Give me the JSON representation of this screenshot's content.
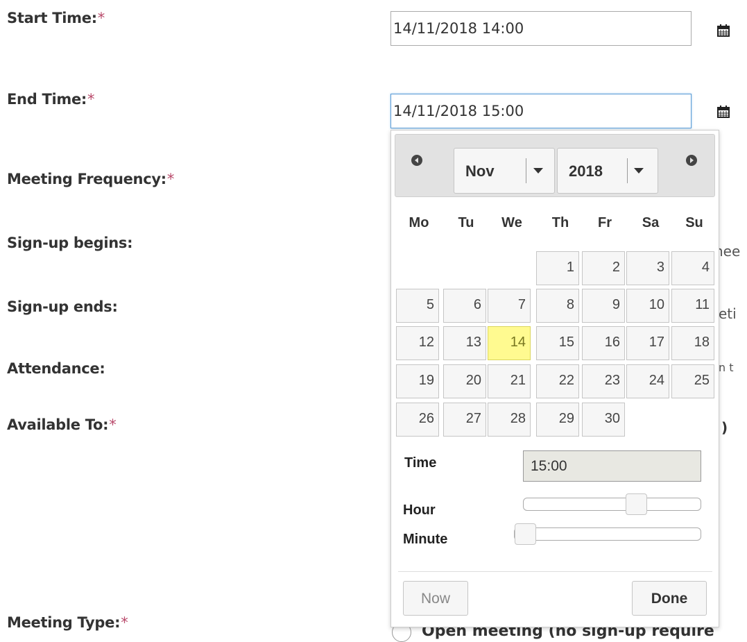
{
  "form": {
    "start_time_label": "Start Time:",
    "end_time_label": "End Time:",
    "meeting_frequency_label": "Meeting Frequency:",
    "signup_begins_label": "Sign-up begins:",
    "signup_ends_label": "Sign-up ends:",
    "attendance_label": "Attendance:",
    "available_to_label": "Available To:",
    "meeting_type_label": "Meeting Type:",
    "required_marker": "*",
    "start_time_value": "14/11/2018 14:00",
    "end_time_value": "14/11/2018 15:00"
  },
  "background_fragments": {
    "signup_begins_frag": "nee",
    "signup_ends_frag": "eti",
    "attendance_frag": "n t",
    "available_to_frag": ")",
    "meeting_type_option": "Open meeting (no sign-up require"
  },
  "datepicker": {
    "month": "Nov",
    "year": "2018",
    "weekdays": [
      "Mo",
      "Tu",
      "We",
      "Th",
      "Fr",
      "Sa",
      "Su"
    ],
    "weeks": [
      [
        "",
        "",
        "",
        "1",
        "2",
        "3",
        "4"
      ],
      [
        "5",
        "6",
        "7",
        "8",
        "9",
        "10",
        "11"
      ],
      [
        "12",
        "13",
        "14",
        "15",
        "16",
        "17",
        "18"
      ],
      [
        "19",
        "20",
        "21",
        "22",
        "23",
        "24",
        "25"
      ],
      [
        "26",
        "27",
        "28",
        "29",
        "30",
        "",
        ""
      ]
    ],
    "selected_day": "14",
    "time_label": "Time",
    "time_value": "15:00",
    "hour_label": "Hour",
    "minute_label": "Minute",
    "hour_value": 15,
    "hour_max": 23,
    "minute_value": 0,
    "minute_max": 59,
    "now_label": "Now",
    "done_label": "Done"
  },
  "colors": {
    "required": "#b94a6b",
    "selected_day_bg": "#fffa90",
    "focus_border": "#5b9bd5"
  },
  "icons": {
    "calendar": "calendar-icon",
    "prev": "prev-month-icon",
    "next": "next-month-icon"
  }
}
